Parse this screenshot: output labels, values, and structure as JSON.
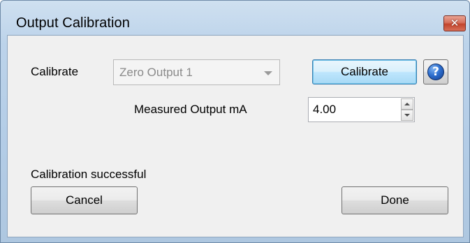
{
  "window": {
    "title": "Output Calibration",
    "close_symbol": "✕"
  },
  "form": {
    "calibrate_label": "Calibrate",
    "output_select": {
      "value": "Zero Output 1",
      "disabled": true
    },
    "calibrate_button": "Calibrate",
    "help_symbol": "?",
    "measured_label": "Measured Output mA",
    "measured_value": "4.00"
  },
  "status_text": "Calibration successful",
  "footer": {
    "cancel_label": "Cancel",
    "done_label": "Done"
  },
  "colors": {
    "accent": "#3c7fb1",
    "close_button": "#c2442c",
    "help_icon": "#2d6fcf"
  },
  "icons": {
    "close": "close-icon",
    "help": "help-icon",
    "dropdown": "chevron-down-icon",
    "spin_up": "spin-up-icon",
    "spin_down": "spin-down-icon"
  }
}
